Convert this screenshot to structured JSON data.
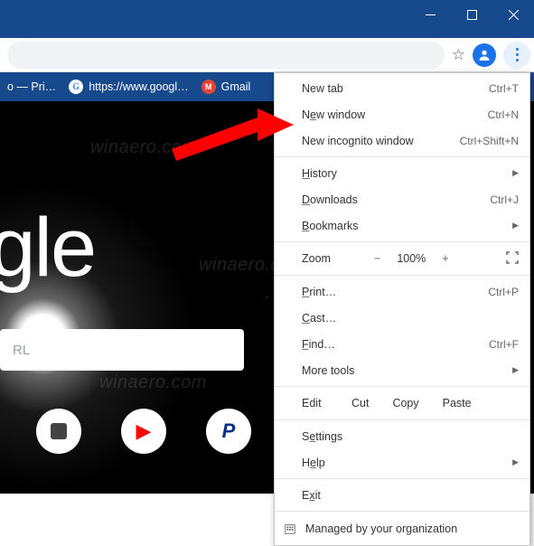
{
  "window": {
    "title": ""
  },
  "bookmarks": {
    "items": [
      {
        "label": "o — Pri…"
      },
      {
        "label": "https://www.googl…"
      },
      {
        "label": "Gmail"
      }
    ]
  },
  "page": {
    "logo": "oogle",
    "search_placeholder": "RL",
    "watermark": "winaero.com"
  },
  "menu": {
    "new_tab": {
      "label": "New tab",
      "accel": "Ctrl+T"
    },
    "new_window": {
      "label_pre": "N",
      "label_u": "e",
      "label_post": "w window",
      "accel": "Ctrl+N"
    },
    "incognito": {
      "label": "New incognito window",
      "accel": "Ctrl+Shift+N"
    },
    "history": {
      "label_pre": "",
      "label_u": "H",
      "label_post": "istory"
    },
    "downloads": {
      "label_pre": "",
      "label_u": "D",
      "label_post": "ownloads",
      "accel": "Ctrl+J"
    },
    "bookmarks": {
      "label_pre": "",
      "label_u": "B",
      "label_post": "ookmarks"
    },
    "zoom": {
      "label": "Zoom",
      "minus": "−",
      "value": "100%",
      "plus": "+"
    },
    "print": {
      "label_pre": "",
      "label_u": "P",
      "label_post": "rint…",
      "accel": "Ctrl+P"
    },
    "cast": {
      "label_pre": "",
      "label_u": "C",
      "label_post": "ast…"
    },
    "find": {
      "label_pre": "",
      "label_u": "F",
      "label_post": "ind…",
      "accel": "Ctrl+F"
    },
    "more_tools": {
      "label": "More tools"
    },
    "edit": {
      "label": "Edit",
      "cut": "Cut",
      "copy": "Copy",
      "paste": "Paste"
    },
    "settings": {
      "label_pre": "S",
      "label_u": "e",
      "label_post": "ttings"
    },
    "help": {
      "label_pre": "H",
      "label_u": "e",
      "label_post": "lp"
    },
    "exit": {
      "label_pre": "E",
      "label_u": "x",
      "label_post": "it"
    },
    "managed": {
      "label": "Managed by your organization"
    }
  }
}
